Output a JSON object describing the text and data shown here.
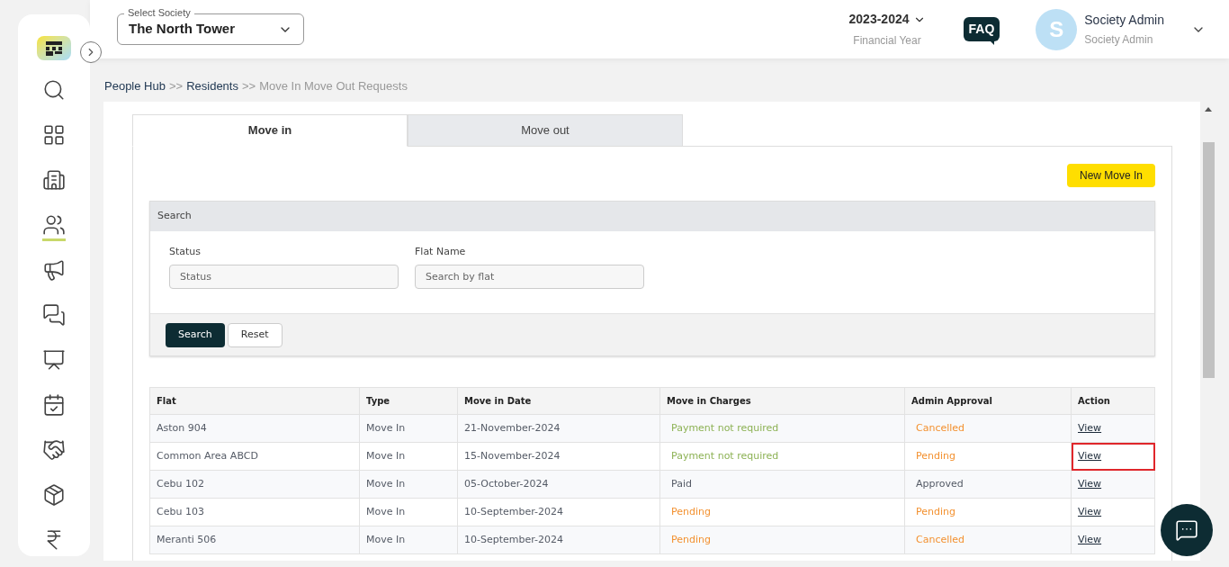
{
  "sidebar": {
    "items": [
      {
        "selected": false
      },
      {
        "selected": false
      },
      {
        "selected": false
      },
      {
        "selected": true
      },
      {
        "selected": false
      },
      {
        "selected": false
      },
      {
        "selected": false
      },
      {
        "selected": false
      },
      {
        "selected": false
      },
      {
        "selected": false
      },
      {
        "selected": false
      }
    ]
  },
  "header": {
    "society_select": {
      "label": "Select Society",
      "value": "The North Tower"
    },
    "year": {
      "value": "2023-2024",
      "caption": "Financial Year"
    },
    "faq": "FAQ",
    "user": {
      "initial": "S",
      "name": "Society Admin",
      "role": "Society Admin"
    }
  },
  "breadcrumb": [
    {
      "text": "People Hub",
      "current": false
    },
    {
      "text": ">>",
      "kind": "sep"
    },
    {
      "text": "Residents",
      "current": false
    },
    {
      "text": ">>",
      "kind": "sep"
    },
    {
      "text": "Move In Move Out Requests",
      "current": true
    }
  ],
  "tabs": [
    {
      "label": "Move in",
      "selected": true
    },
    {
      "label": "Move out",
      "selected": false
    }
  ],
  "new_button": "New Move In",
  "search": {
    "title": "Search",
    "fields": [
      {
        "label": "Status",
        "placeholder": "Status"
      },
      {
        "label": "Flat Name",
        "placeholder": "Search by flat"
      }
    ],
    "buttons": [
      {
        "label": "Search",
        "kind": "primary"
      },
      {
        "label": "Reset",
        "kind": "secondary"
      }
    ]
  },
  "table": {
    "columns": [
      "Flat",
      "Type",
      "Move in Date",
      "Move in Charges",
      "Admin Approval",
      "Action"
    ],
    "rows": [
      {
        "flat": "Aston 904",
        "type": "Move In",
        "date": "21-November-2024",
        "charges": {
          "text": "Payment not required",
          "color": "#8db255"
        },
        "approval": {
          "text": "Cancelled",
          "color": "#f39130"
        },
        "action": "View",
        "highlighted": false
      },
      {
        "flat": "Common Area ABCD",
        "type": "Move In",
        "date": "15-November-2024",
        "charges": {
          "text": "Payment not required",
          "color": "#8db255"
        },
        "approval": {
          "text": "Pending",
          "color": "#f39130"
        },
        "action": "View",
        "highlighted": true
      },
      {
        "flat": "Cebu 102",
        "type": "Move In",
        "date": "05-October-2024",
        "charges": {
          "text": "Paid",
          "color": "#555b66"
        },
        "approval": {
          "text": "Approved",
          "color": "#555b66"
        },
        "action": "View",
        "highlighted": false
      },
      {
        "flat": "Cebu 103",
        "type": "Move In",
        "date": "10-September-2024",
        "charges": {
          "text": "Pending",
          "color": "#f39130"
        },
        "approval": {
          "text": "Pending",
          "color": "#f39130"
        },
        "action": "View",
        "highlighted": false
      },
      {
        "flat": "Meranti 506",
        "type": "Move In",
        "date": "10-September-2024",
        "charges": {
          "text": "Pending",
          "color": "#f39130"
        },
        "approval": {
          "text": "Cancelled",
          "color": "#f39130"
        },
        "action": "View",
        "highlighted": false
      }
    ]
  }
}
